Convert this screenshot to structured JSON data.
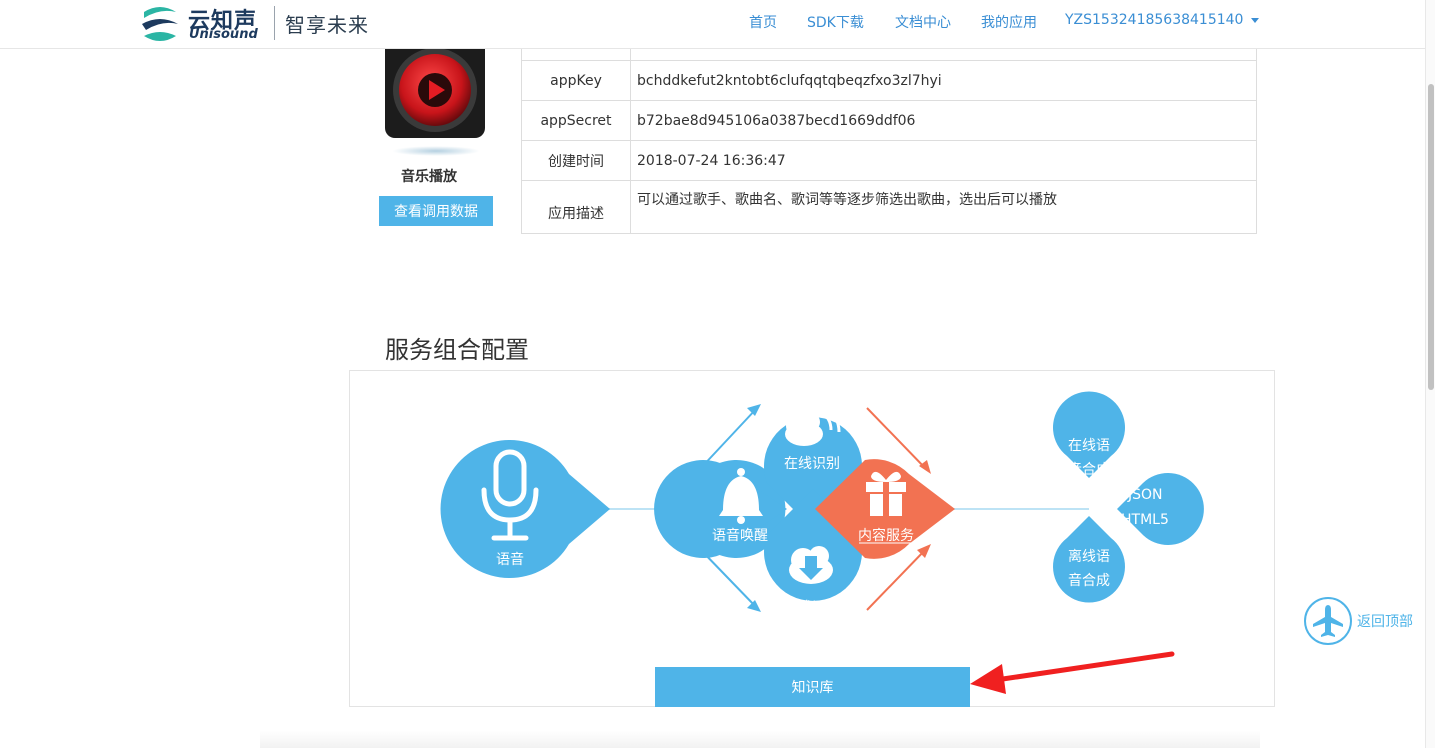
{
  "header": {
    "logo_cn": "云知声",
    "logo_en": "Unisound",
    "slogan": "智享未来",
    "nav": [
      {
        "label": "首页"
      },
      {
        "label": "SDK下载"
      },
      {
        "label": "文档中心"
      },
      {
        "label": "我的应用"
      }
    ],
    "user": "YZS15324185638415140"
  },
  "app": {
    "name": "音乐播放",
    "view_data_button": "查看调用数据",
    "rows": [
      {
        "key": "appKey",
        "value": "bchddkefut2kntobt6clufqqtqbeqzfxo3zl7hyi"
      },
      {
        "key": "appSecret",
        "value": "b72bae8d945106a0387becd1669ddf06"
      },
      {
        "key": "创建时间",
        "value": "2018-07-24 16:36:47"
      },
      {
        "key": "应用描述",
        "value": "可以通过歌手、歌曲名、歌词等等逐步筛选出歌曲，选出后可以播放"
      }
    ]
  },
  "service": {
    "title": "服务组合配置",
    "nodes": {
      "voice": "语音",
      "online_asr": "在线识别",
      "wakeup": "语音唤醒",
      "offline_asr": "离线识别",
      "content": "内容服务",
      "online_tts_1": "在线语",
      "online_tts_2": "音合成",
      "offline_tts_1": "离线语",
      "offline_tts_2": "音合成",
      "out_1": "JSON",
      "out_2": "HTML5"
    },
    "knowledge_base": "知识库"
  },
  "colors": {
    "accent": "#4fb4e8",
    "content_orange": "#f27252",
    "nav_link": "#3a8ed4",
    "annotation_red": "#f02020"
  },
  "back_to_top": "返回顶部"
}
